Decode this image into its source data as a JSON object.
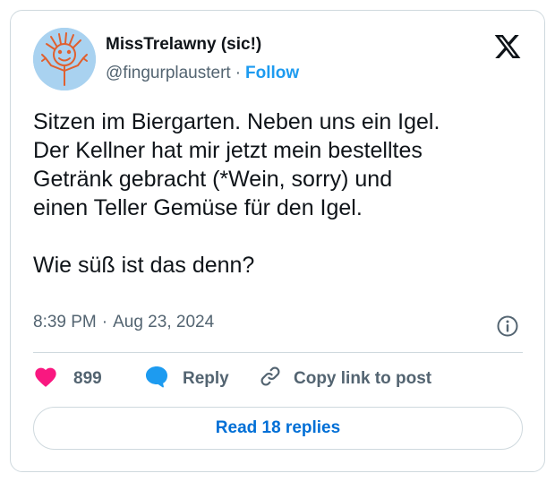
{
  "author": {
    "display_name": "MissTrelawny (sic!)",
    "handle": "@fingurplaustert",
    "separator": "·",
    "follow_label": "Follow"
  },
  "tweet": {
    "paragraph1": [
      "Sitzen im Biergarten. Neben uns ein Igel.",
      "Der Kellner hat mir jetzt mein bestelltes",
      "Getränk gebracht (*Wein, sorry) und",
      "einen Teller Gemüse für den Igel."
    ],
    "paragraph2": "Wie süß ist das denn?",
    "time": "8:39 PM",
    "separator": "·",
    "date": "Aug 23, 2024"
  },
  "actions": {
    "like_count": "899",
    "reply_label": "Reply",
    "copy_link_label": "Copy link to post"
  },
  "footer": {
    "read_replies_label": "Read 18 replies"
  },
  "icons": {
    "logo": "x-logo-icon",
    "info": "info-icon",
    "like": "heart-icon",
    "reply": "speech-bubble-icon",
    "copy": "link-icon"
  },
  "colors": {
    "accent": "#1d9bf0",
    "like": "#f91880",
    "text": "#0f1419",
    "muted": "#536471",
    "border": "#cfd9de"
  }
}
